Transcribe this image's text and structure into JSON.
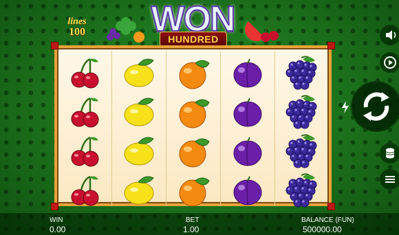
{
  "logo": {
    "lines_label": "lines",
    "lines_count": "100",
    "title": "WON",
    "subtitle": "HUNDRED"
  },
  "reels": [
    {
      "symbol": "cherry",
      "rows": [
        "cherry",
        "cherry",
        "cherry",
        "cherry"
      ]
    },
    {
      "symbol": "lemon",
      "rows": [
        "lemon",
        "lemon",
        "lemon",
        "lemon"
      ]
    },
    {
      "symbol": "orange",
      "rows": [
        "orange",
        "orange",
        "orange",
        "orange"
      ]
    },
    {
      "symbol": "plum",
      "rows": [
        "plum",
        "plum",
        "plum",
        "plum"
      ]
    },
    {
      "symbol": "grapes",
      "rows": [
        "grapes",
        "grapes",
        "grapes",
        "grapes"
      ]
    }
  ],
  "status": {
    "win_label": "WIN",
    "win_value": "0.00",
    "bet_label": "BET",
    "bet_value": "1.00",
    "balance_label": "BALANCE (FUN)",
    "balance_value": "500000.00"
  },
  "controls": {
    "sound_icon": "speaker-icon",
    "autoplay_icon": "play-circle-icon",
    "turbo_icon": "lightning-icon",
    "spin_icon": "refresh-arrows-icon",
    "bet_icon": "coin-stack-icon",
    "menu_icon": "hamburger-menu-icon"
  },
  "colors": {
    "background": "#1f7a1f",
    "frame": "#e9a43a",
    "reel_bg": "#fff8e8",
    "accent_red": "#c01818"
  }
}
